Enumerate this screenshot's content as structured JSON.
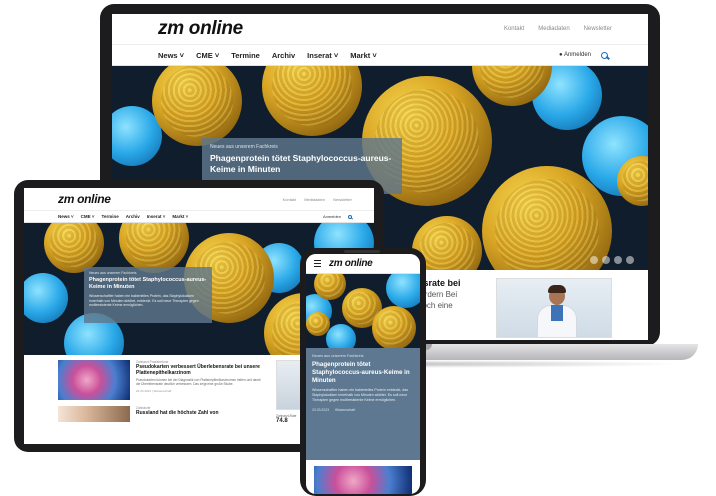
{
  "brand": {
    "logo": "zm online"
  },
  "laptop": {
    "util_links": [
      "Kontakt",
      "Mediadaten",
      "Newsletter"
    ],
    "nav": [
      "News ˅",
      "CME ˅",
      "Termine",
      "Archiv",
      "Inserat ˅",
      "Markt ˅"
    ],
    "login": "Anmelden",
    "hero_kicker": "Neues aus unserem Fachkreis",
    "hero_title": "Phagenprotein tötet Staphylococcus-aureus-Keime in Minuten",
    "below_title": "nsrate bei",
    "below_text": "fordern Bei\nnoch eine"
  },
  "tablet": {
    "util_links": [
      "Kontakt",
      "Mediadaten",
      "Newsletter"
    ],
    "nav": [
      "News ˅",
      "CME ˅",
      "Termine",
      "Archiv",
      "Inserat ˅",
      "Markt ˅"
    ],
    "login": "Anmelden",
    "hero_kicker": "Neues aus unserem Fachkreis",
    "hero_title": "Phagenprotein tötet Staphylococcus-aureus-Keime in Minuten",
    "hero_teaser": "Wissenschaftler haben ein bakterielles Protein, das Staphylokokken innerhalb von Minuten abtötet, entdeckt. Es soll neue Therapien gegen multiresistente Keime ermöglichen.",
    "article1": {
      "kicker": "Zahnarzt-Praxisbefund",
      "title": "Pseudokarten verbessert Überlebensrate bei unsere Plattenepithelkarzinom",
      "teaser": "Pseudokarten können bei der Diagnostik von Plattenepithelkarzinomen helfen und damit die Überlebensrate deutlich verbessern. Das zeigt eine große Studie.",
      "meta": "23.03.2023 | Wissenschaft"
    },
    "article2": {
      "kicker": "Zahnärzte",
      "title": "Russland hat die höchste Zahl von"
    },
    "side_caption": "Zahnarzt-Rate",
    "side_number": "74.8"
  },
  "phone": {
    "hero_kicker": "Neues aus unserem Fachkreis",
    "hero_title": "Phagenprotein tötet Staphylococcus-aureus-Keime in Minuten",
    "hero_teaser": "Wissenschaftler haben ein bakterielles Protein entdeckt, das Staphylokokken innerhalb von Minuten abtötet. Es soll neue Therapien gegen multiresistente Keime ermöglichen.",
    "date": "23.03.2023",
    "category": "Wissenschaft"
  },
  "colors": {
    "accent": "#1b6fb8",
    "hero_card": "#5f788c"
  },
  "icons": [
    "search-icon",
    "user-icon",
    "menu-icon"
  ]
}
